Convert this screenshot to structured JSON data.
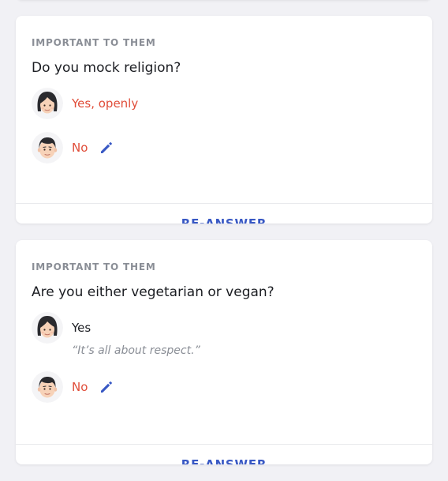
{
  "colors": {
    "background": "#f1f1f5",
    "card": "#ffffff",
    "accent": "#3858c4",
    "answer_mismatch": "#e04d39",
    "muted": "#8a8e96",
    "text": "#1b1d22"
  },
  "cards": [
    {
      "eyebrow": "IMPORTANT TO THEM",
      "question": "Do you mock religion?",
      "their_answer": {
        "avatar": "woman-avatar-icon",
        "text": "Yes, openly",
        "color": "#e04d39"
      },
      "my_answer": {
        "avatar": "man-avatar-icon",
        "text": "No",
        "color": "#e04d39",
        "edit_icon": "pencil-icon"
      },
      "action": "RE-ANSWER"
    },
    {
      "eyebrow": "IMPORTANT TO THEM",
      "question": "Are you either vegetarian or vegan?",
      "their_answer": {
        "avatar": "woman-avatar-icon",
        "text": "Yes",
        "color": "#1b1d22",
        "explanation": "“It’s all about respect.”"
      },
      "my_answer": {
        "avatar": "man-avatar-icon",
        "text": "No",
        "color": "#e04d39",
        "edit_icon": "pencil-icon"
      },
      "action": "RE-ANSWER"
    }
  ]
}
